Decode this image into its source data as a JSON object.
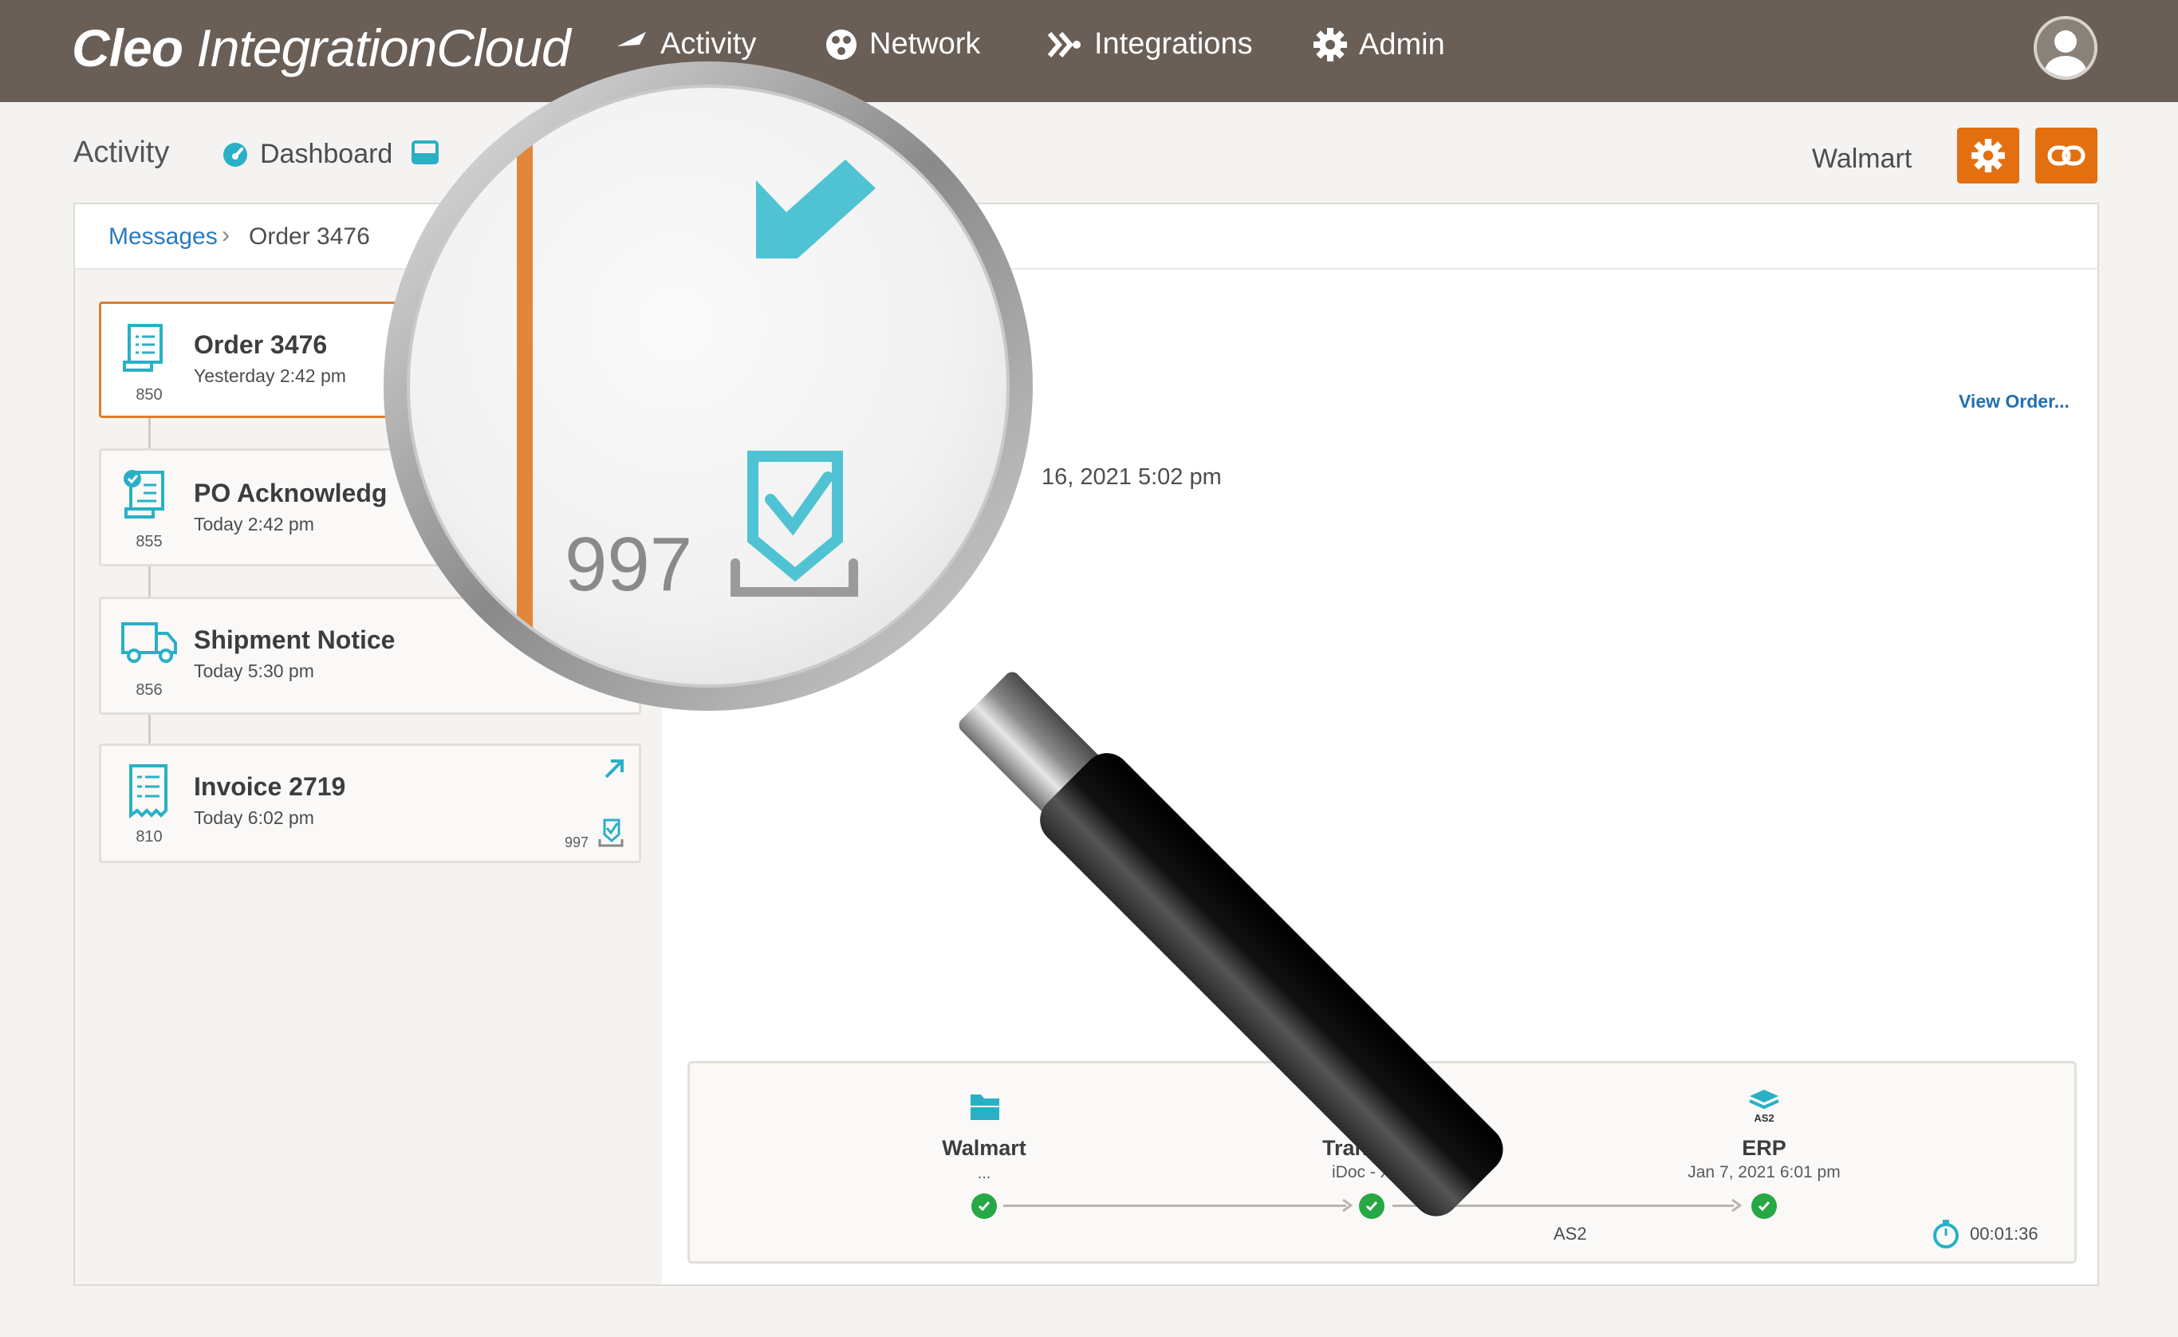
{
  "header": {
    "logo_bold": "Cleo",
    "logo_rest": " IntegrationCloud",
    "nav": [
      {
        "label": "Activity",
        "icon": "activity-icon"
      },
      {
        "label": "Network",
        "icon": "network-icon"
      },
      {
        "label": "Integrations",
        "icon": "integrations-icon"
      },
      {
        "label": "Admin",
        "icon": "gear-icon"
      }
    ]
  },
  "subnav": {
    "title": "Activity",
    "dashboard_label": "Dashboard",
    "partner": "Walmart"
  },
  "breadcrumb": {
    "root": "Messages",
    "current": "Order 3476"
  },
  "messages": [
    {
      "title": "Order 3476",
      "time": "Yesterday 2:42 pm",
      "code": "850",
      "selected": true,
      "icon": "order-document-icon"
    },
    {
      "title": "PO Acknowledg",
      "time": "Today 2:42 pm",
      "code": "855",
      "icon": "po-acknowledgment-icon"
    },
    {
      "title": "Shipment Notice",
      "time": "Today 5:30 pm",
      "code": "856",
      "icon": "truck-icon"
    },
    {
      "title": "Invoice 2719",
      "time": "Today 6:02 pm",
      "code": "810",
      "icon": "invoice-icon",
      "ack_code": "997"
    }
  ],
  "detail": {
    "view_order": "View Order...",
    "date_fragment": "16, 2021 5:02 pm"
  },
  "magnifier": {
    "code": "997"
  },
  "flow": {
    "nodes": [
      {
        "name": "Walmart",
        "sub": "...",
        "icon": "folder-icon"
      },
      {
        "name": "Trans",
        "sub": "iDoc - X1",
        "icon": "transform-icon"
      },
      {
        "name": "ERP",
        "sub": "Jan 7, 2021  6:01 pm",
        "icon": "as2-stack-icon"
      }
    ],
    "edge_label": "AS2",
    "duration": "00:01:36",
    "as2_icon_text": "AS2"
  },
  "colors": {
    "header_bg": "#6a5f57",
    "accent_orange": "#e46f10",
    "teal": "#2ab0c6",
    "link_blue": "#2a7bbf",
    "success_green": "#27a844"
  }
}
